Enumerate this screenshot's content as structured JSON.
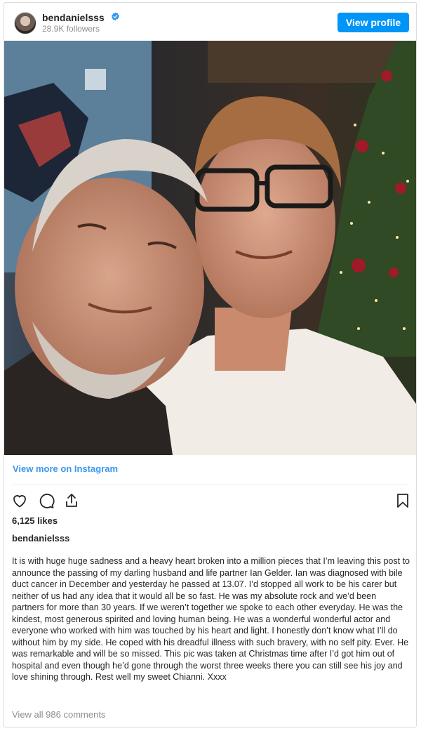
{
  "header": {
    "username": "bendanielsss",
    "followers": "28.9K followers",
    "view_profile_label": "View profile",
    "verified_icon": "verified-badge-icon"
  },
  "colors": {
    "accent_button": "#0095f6",
    "link": "#3897f0",
    "muted_text": "#8e8e8e",
    "text": "#262626",
    "border": "#dbdbdb"
  },
  "post": {
    "view_more_label": "View more on Instagram",
    "actions": {
      "like_icon": "heart-icon",
      "comment_icon": "comment-icon",
      "share_icon": "share-icon",
      "save_icon": "bookmark-icon"
    },
    "likes": "6,125 likes",
    "caption_username": "bendanielsss",
    "caption_text": "It is with huge huge sadness and a heavy heart broken into a million pieces that I’m leaving this post to announce the passing of my darling husband and life partner Ian Gelder. Ian was diagnosed with bile duct cancer in December and yesterday he passed at 13.07. I’d stopped all work to be his carer but neither of us had any idea that it would all be so fast. He was my absolute rock and we’d been partners for more than 30 years. If we weren’t together we spoke to each other everyday. He was the kindest, most generous spirited and loving human being. He was a wonderful wonderful actor and everyone who worked with him was touched by his heart and light. I honestly don’t know what I’ll do without him by my side. He coped with his dreadful illness with such bravery, with no self pity. Ever. He was remarkable and will be so missed. This pic was taken at Christmas time after I’d got him out of hospital and even though he’d gone through the worst three weeks there you can still see his joy and love shining through. Rest well my sweet Chianni. Xxxx",
    "view_comments_label": "View all 986 comments"
  }
}
